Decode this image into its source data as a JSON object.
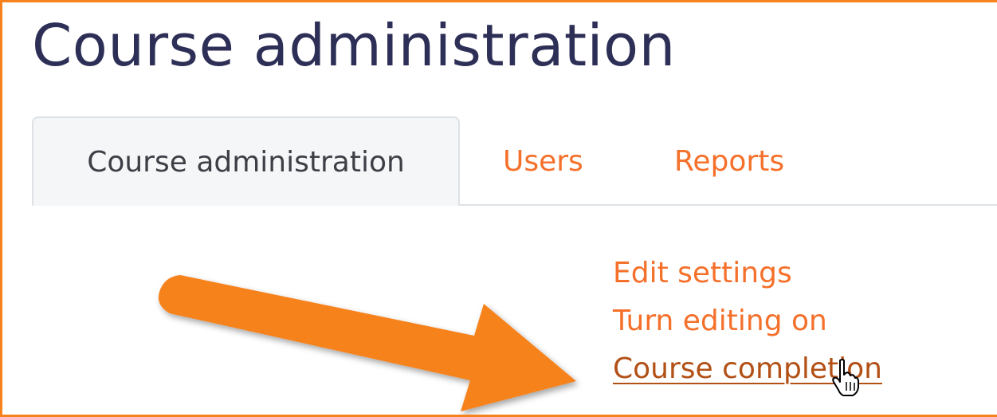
{
  "page": {
    "title": "Course administration"
  },
  "tabs": [
    {
      "label": "Course administration",
      "active": true
    },
    {
      "label": "Users",
      "active": false
    },
    {
      "label": "Reports",
      "active": false
    }
  ],
  "links": [
    {
      "label": "Edit settings"
    },
    {
      "label": "Turn editing on"
    },
    {
      "label": "Course completion",
      "hovered": true
    }
  ],
  "annotation": {
    "arrow_color": "#f6821e",
    "points_to": "Course completion"
  },
  "cursor": {
    "icon": "hand-pointer-icon"
  },
  "colors": {
    "title": "#2d2f56",
    "link": "#f5702a",
    "link_hover": "#b25016",
    "active_tab_bg": "#f5f6f8",
    "frame_border": "#f6821e"
  }
}
